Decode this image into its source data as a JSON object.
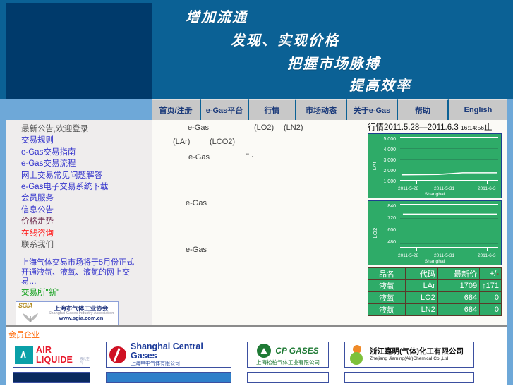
{
  "banner": {
    "lines": [
      "增加流通",
      "发现、实现价格",
      "把握市场脉搏",
      "提高效率"
    ]
  },
  "nav": {
    "items": [
      {
        "label": "首页/注册",
        "name": "nav-home-register"
      },
      {
        "label": "e-Gas平台",
        "name": "nav-egas-platform"
      },
      {
        "label": "行情",
        "name": "nav-quotes"
      },
      {
        "label": "市场动态",
        "name": "nav-market-news"
      },
      {
        "label": "关于e-Gas",
        "name": "nav-about-egas"
      },
      {
        "label": "帮助",
        "name": "nav-help"
      },
      {
        "label": "English",
        "name": "nav-english"
      }
    ]
  },
  "sidebar": {
    "links": [
      {
        "label": "最新公告,欢迎登录",
        "color": "mixed"
      },
      {
        "label": "交易规则",
        "color": "blue"
      },
      {
        "label": "e-Gas交易指南",
        "color": "blue"
      },
      {
        "label": "e-Gas交易流程",
        "color": "blue"
      },
      {
        "label": "网上交易常见问题解答",
        "color": "blue"
      },
      {
        "label": "e-Gas电子交易系统下载",
        "color": "blue"
      },
      {
        "label": "会员服务",
        "color": "blue"
      },
      {
        "label": "信息公告",
        "color": "blue"
      },
      {
        "label": "价格走势",
        "color": "purple"
      },
      {
        "label": "在线咨询",
        "color": "red"
      },
      {
        "label": "联系我们",
        "color": "gray"
      }
    ],
    "note": "上海气体交易市场将于5月份正式开通液氩、液氧、液氮的网上交易…",
    "quote": "交易所\"新\"",
    "sgia": {
      "mark_text": "SGIA",
      "cn": "上海市气体工业协会",
      "en": "Shanghai Gases Industry Association",
      "url": "www.sgia.com.cn"
    }
  },
  "center": {
    "fragments": [
      {
        "text": "e-Gas",
        "name": "center-egas-1"
      },
      {
        "text": "(LO2)",
        "name": "center-lo2-label"
      },
      {
        "text": "(LN2)",
        "name": "center-ln2-label"
      },
      {
        "text": "(LAr)",
        "name": "center-lar-label"
      },
      {
        "text": "(LCO2)",
        "name": "center-lco2-label"
      },
      {
        "text": "e-Gas",
        "name": "center-egas-2"
      },
      {
        "text": "\" ·",
        "name": "center-quote-fragment"
      },
      {
        "text": "e-Gas",
        "name": "center-egas-3"
      },
      {
        "text": "e-Gas",
        "name": "center-egas-4"
      }
    ]
  },
  "right": {
    "title_prefix": "行情",
    "date_range": "2011.5.28—2011.6.3",
    "time": "16:14:56",
    "title_suffix": "止",
    "table": {
      "headers": [
        "品名",
        "代码",
        "最新价",
        "+/-"
      ],
      "rows": [
        {
          "name": "液氩",
          "code": "LAr",
          "price": "1709",
          "change": "↑171",
          "dir": "up"
        },
        {
          "name": "液氧",
          "code": "LO2",
          "price": "684",
          "change": "0",
          "dir": "flat"
        },
        {
          "name": "液氮",
          "code": "LN2",
          "price": "684",
          "change": "0",
          "dir": "flat"
        }
      ]
    }
  },
  "chart_data": [
    {
      "type": "line",
      "title": "",
      "ylabel": "LAr",
      "xlabel": "Shanghai",
      "x": [
        "2011-5-28",
        "2011-5-31",
        "2011-6-3"
      ],
      "yticks": [
        "5,000",
        "4,000",
        "3,000",
        "2,000",
        "1,000"
      ],
      "ylim": [
        1000,
        5000
      ],
      "series": [
        {
          "name": "LAr",
          "values": [
            1538,
            1555,
            1709,
            1709
          ]
        }
      ],
      "grid": true,
      "legend": "none"
    },
    {
      "type": "line",
      "title": "",
      "ylabel": "LO2",
      "xlabel": "Shanghai",
      "x": [
        "2011-5-28",
        "2011-5-31",
        "2011-6-3"
      ],
      "yticks": [
        "840",
        "720",
        "600",
        "480"
      ],
      "ylim": [
        480,
        840
      ],
      "series": [
        {
          "name": "LO2",
          "values": [
            684,
            684,
            684,
            684
          ]
        }
      ],
      "grid": true,
      "legend": "none"
    }
  ],
  "footer": {
    "title": "会员企业",
    "logos": [
      {
        "name": "air-liquide",
        "mark": "AL",
        "text": "AIR LIQUIDE",
        "sub": "液化空气"
      },
      {
        "name": "shanghai-central-gases",
        "en": "Shanghai Central Gases",
        "cn": "上海申中气体有限公司"
      },
      {
        "name": "cp-gases",
        "en": "CP GASES",
        "cn": "上海松柏气体工业有限公司"
      },
      {
        "name": "zhejiang-jiaming",
        "cn": "浙江嘉明(气体)化工有限公司",
        "en": "Zhejiang Jiaming(Air)Chemical Co.,Ltd"
      }
    ]
  }
}
